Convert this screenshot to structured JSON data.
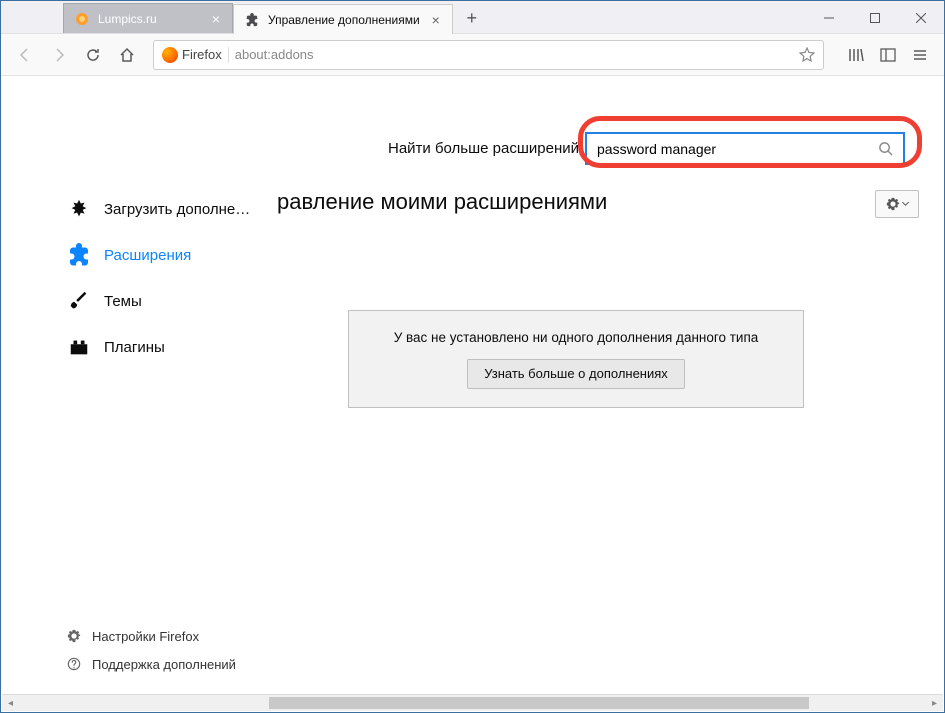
{
  "window": {
    "minimize_label": "—",
    "maximize_label": "▢",
    "close_label": "✕"
  },
  "tabs": [
    {
      "label": "Lumpics.ru",
      "active": false
    },
    {
      "label": "Управление дополнениями",
      "active": true
    }
  ],
  "toolbar": {
    "identity_label": "Firefox",
    "url": "about:addons"
  },
  "addons": {
    "search_label": "Найти больше расширений",
    "search_value": "password manager",
    "heading": "равление моими расширениями",
    "sidebar": {
      "get_addons": "Загрузить дополне…",
      "extensions": "Расширения",
      "themes": "Темы",
      "plugins": "Плагины"
    },
    "empty_message": "У вас не установлено ни одного дополнения данного типа",
    "learn_more": "Узнать больше о дополнениях",
    "footer": {
      "preferences": "Настройки Firefox",
      "support": "Поддержка дополнений"
    }
  }
}
